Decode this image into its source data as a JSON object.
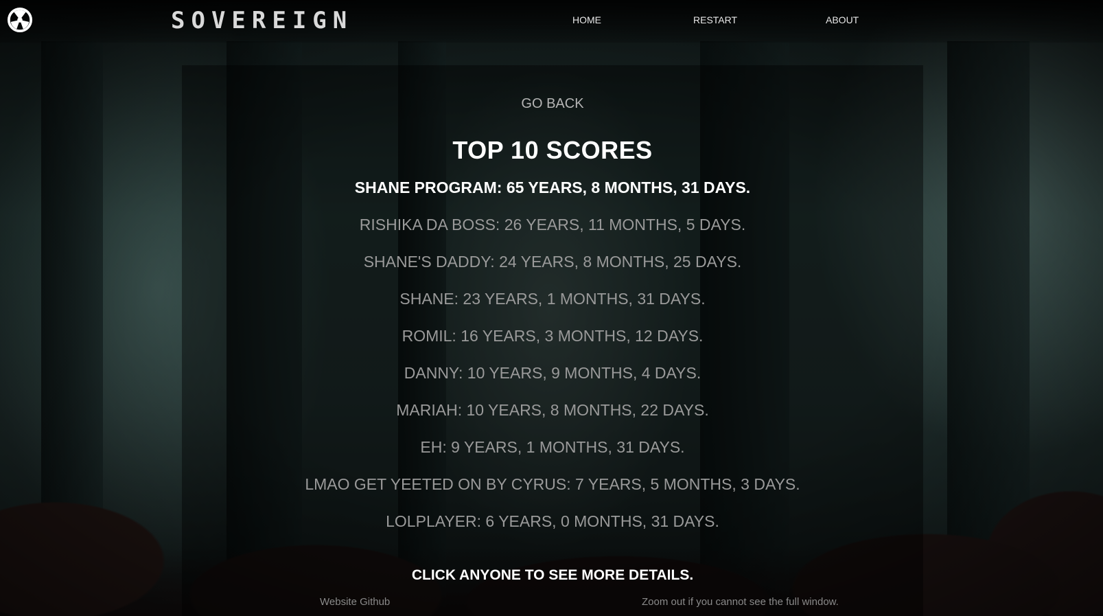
{
  "header": {
    "brand": "SOVEREIGN",
    "logo_icon": "radiation-icon",
    "nav": [
      {
        "label": "HOME"
      },
      {
        "label": "RESTART"
      },
      {
        "label": "ABOUT"
      }
    ]
  },
  "panel": {
    "go_back_label": "GO BACK",
    "title": "TOP 10 SCORES",
    "scores": [
      {
        "text": "SHANE PROGRAM: 65 YEARS, 8 MONTHS, 31 DAYS."
      },
      {
        "text": "RISHIKA DA BOSS: 26 YEARS, 11 MONTHS, 5 DAYS."
      },
      {
        "text": "SHANE'S DADDY: 24 YEARS, 8 MONTHS, 25 DAYS."
      },
      {
        "text": "SHANE: 23 YEARS, 1 MONTHS, 31 DAYS."
      },
      {
        "text": "ROMIL: 16 YEARS, 3 MONTHS, 12 DAYS."
      },
      {
        "text": "DANNY: 10 YEARS, 9 MONTHS, 4 DAYS."
      },
      {
        "text": "MARIAH: 10 YEARS, 8 MONTHS, 22 DAYS."
      },
      {
        "text": "EH: 9 YEARS, 1 MONTHS, 31 DAYS."
      },
      {
        "text": "LMAO GET YEETED ON BY CYRUS: 7 YEARS, 5 MONTHS, 3 DAYS."
      },
      {
        "text": "LOLPLAYER: 6 YEARS, 0 MONTHS, 31 DAYS."
      }
    ],
    "hint": "CLICK ANYONE TO SEE MORE DETAILS."
  },
  "footer": {
    "github_link": "Website Github",
    "note": "Zoom out if you cannot see the full window."
  },
  "colors": {
    "text_primary": "#ffffff",
    "text_muted": "#9a9a9a",
    "panel_bg": "rgba(0,0,0,0.42)"
  }
}
